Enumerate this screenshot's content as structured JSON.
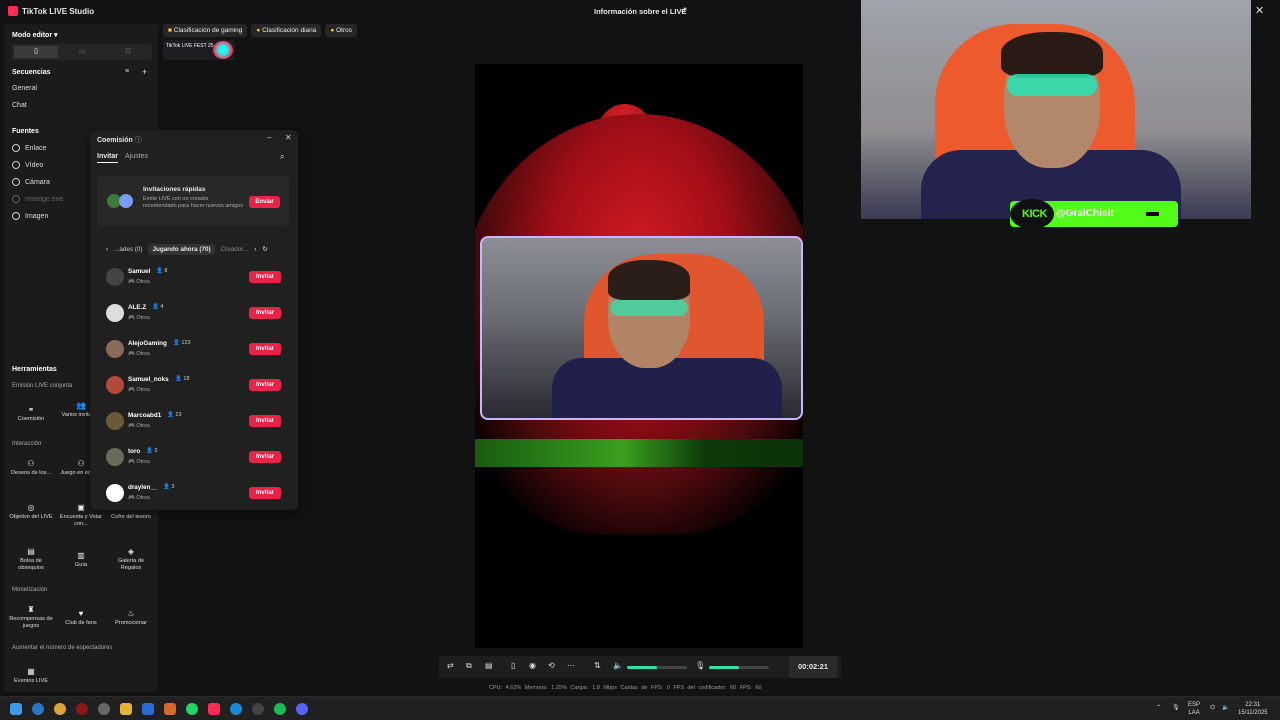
{
  "app": {
    "title": "TikTok LIVE Studio",
    "live_info": "Información sobre el LIVE"
  },
  "sidebar": {
    "mode": "Modo editor",
    "sequences": "Secuencias",
    "seq_items": [
      "General",
      "Chat"
    ],
    "sources": "Fuentes",
    "source_items": [
      "Enlace",
      "Vídeo",
      "Cámara",
      "msedge.exe",
      "Imagen"
    ],
    "tools": "Herramientas",
    "joint_live": "Emisión LIVE conjunta",
    "joint_tools": [
      "Coemisión",
      "Varios invitados"
    ],
    "interaction": "Interacción",
    "interaction_tools": [
      "Deseos de los...",
      "Juego en equipo",
      "Objetivo del LIVE",
      "Encuesta y Votar con...",
      "Cofre del tesoro",
      "Bolsa de obsequios",
      "Guía",
      "Galería de Regalos"
    ],
    "monetization": "Monetización",
    "monetization_tools": [
      "Recompensas de juegos",
      "Club de fans",
      "Promocionar"
    ],
    "viewers": "Aumentar el número de espectadores",
    "viewer_tools": [
      "Eventos LIVE"
    ]
  },
  "rankings": [
    "Clasificación de gaming",
    "Clasificación diaria",
    "Otros"
  ],
  "fest_label": "TikTok LIVE FEST 25",
  "commission": {
    "title": "Coemisión",
    "tabs": [
      "Invitar",
      "Ajustes"
    ],
    "quick_title": "Invitaciones rápidas",
    "quick_desc": "Emite LIVE con un creador recomendado para hacer nuevos amigos",
    "send": "Enviar",
    "filters": [
      "‹",
      "...ades (0)",
      "Jugando ahora (70)",
      "Creador..."
    ],
    "invite": "Invitar",
    "creators": [
      {
        "name": "Samuel",
        "count": "8",
        "cat": "Otros"
      },
      {
        "name": "ALE.Z",
        "count": "4",
        "cat": "Otros"
      },
      {
        "name": "AlejoGaming",
        "count": "123",
        "cat": "Otros"
      },
      {
        "name": "Samuel_noks",
        "count": "18",
        "cat": "Otros"
      },
      {
        "name": "Marcoabd1",
        "count": "23",
        "cat": "Otros"
      },
      {
        "name": "toro",
        "count": "3",
        "cat": "Otros"
      },
      {
        "name": "draylen__",
        "count": "3",
        "cat": "Otros"
      }
    ]
  },
  "bottombar": {
    "timer": "00:02:21",
    "speaker_level": 0.5,
    "mic_level": 0.5
  },
  "stats": "CPU: 4.62%   Memoria: 1.25%   Cargar: 1.8 Mbps   Caídas de FPS: 0   FPS del codificador: 60   FPS: 60",
  "kick": {
    "logo": "KICK",
    "handle": "@GralChisit"
  },
  "taskbar": {
    "lang": "ESP",
    "lang2": "LAA",
    "time": "22:31",
    "date": "15/11/2025"
  }
}
